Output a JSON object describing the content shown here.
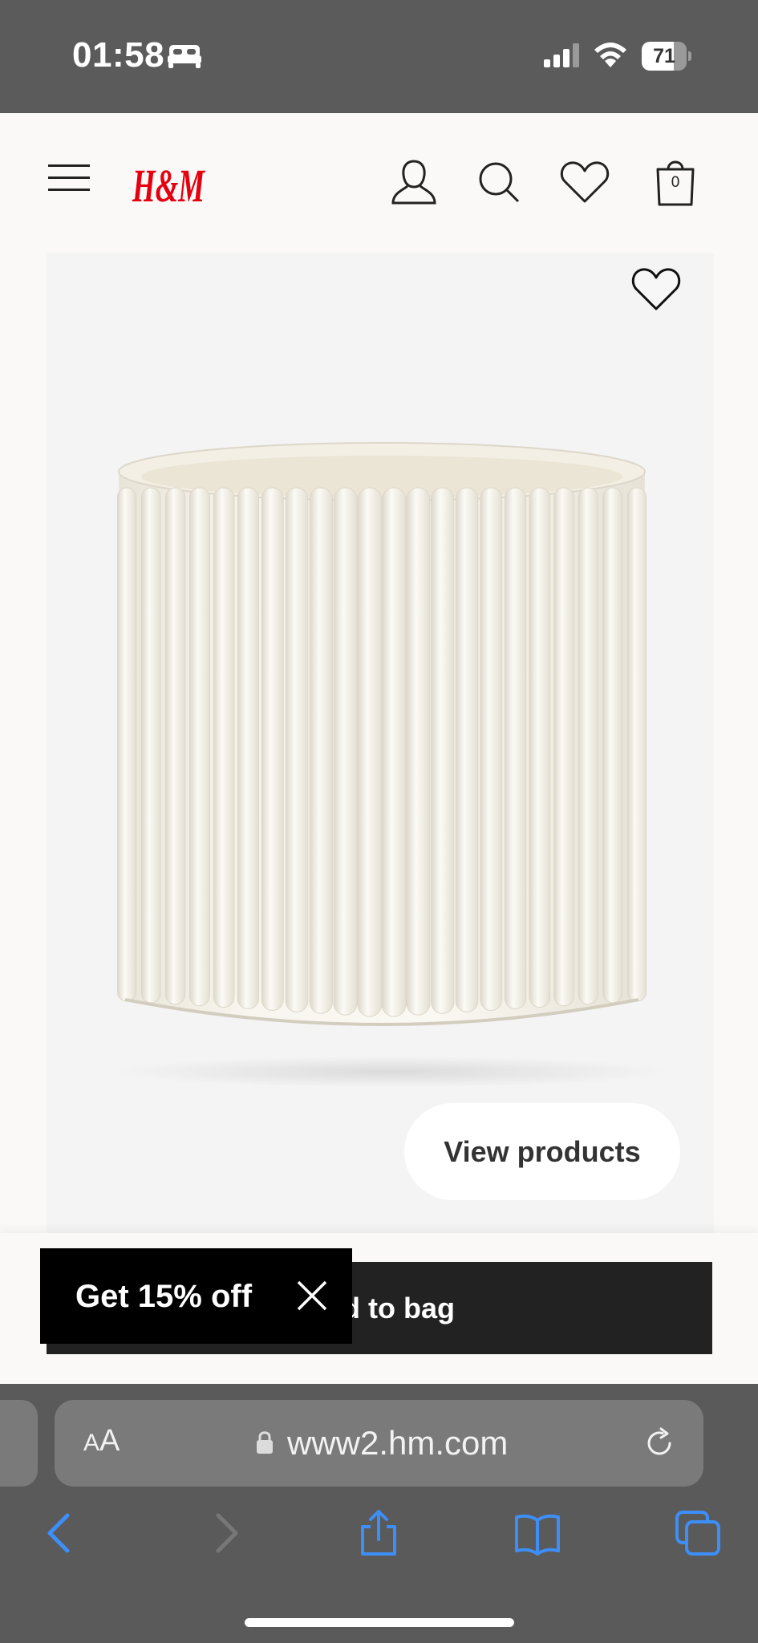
{
  "status_bar": {
    "time": "01:58",
    "battery_level": "71",
    "battery_fraction": 0.71,
    "icons": [
      "sleep-focus-icon",
      "cellular-signal-icon",
      "wifi-icon",
      "battery-icon"
    ]
  },
  "header": {
    "logo_text": "H&M",
    "brand_color": "#e50010",
    "bag_count": "0",
    "icons": [
      "menu-icon",
      "account-icon",
      "search-icon",
      "wishlist-icon",
      "bag-icon"
    ]
  },
  "product": {
    "view_products_label": "View products",
    "favorite_icon": "heart-icon"
  },
  "bottom_bar": {
    "add_to_bag_label": "Add to bag",
    "promo_label": "Get 15% off",
    "promo_close_icon": "close-icon"
  },
  "safari": {
    "text_size_label_small": "A",
    "text_size_label_large": "A",
    "url": "www2.hm.com",
    "accent_color": "#3d8ef7",
    "toolbar_icons": [
      "back-icon",
      "forward-icon",
      "share-icon",
      "bookmarks-icon",
      "tabs-icon"
    ]
  }
}
